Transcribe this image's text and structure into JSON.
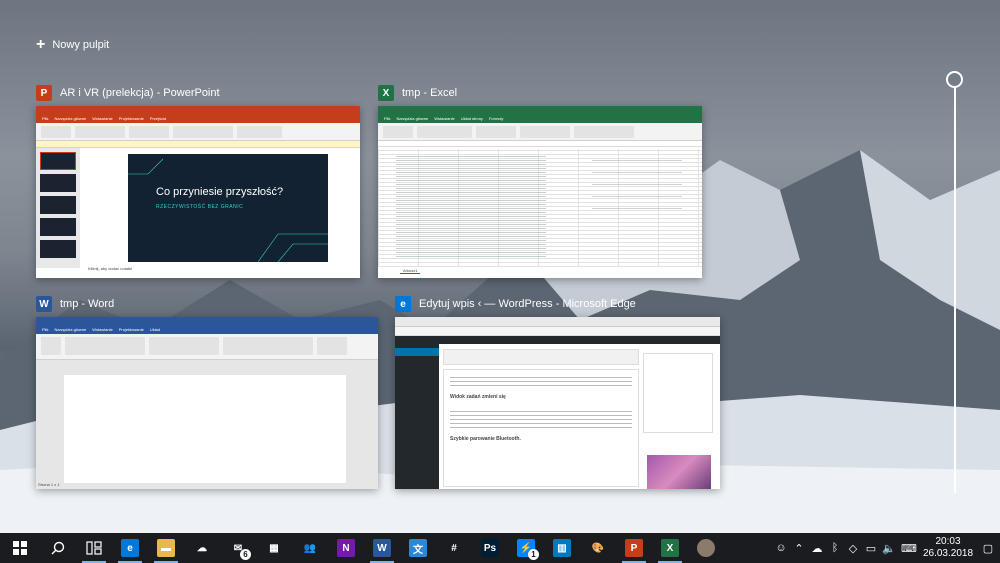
{
  "new_desktop": {
    "label": "Nowy pulpit"
  },
  "windows": [
    {
      "title": "AR i VR (prelekcja) - PowerPoint",
      "icon": "powerpoint-icon",
      "accent": "#c43e1c",
      "slide_title": "Co przyniesie przyszłość?",
      "slide_subtitle": "RZECZYWISTOŚĆ BEZ GRANIC",
      "notes": "Kliknij, aby dodać notatki"
    },
    {
      "title": "tmp - Excel",
      "icon": "excel-icon",
      "accent": "#217346",
      "sheet_tab": "Arkusz1"
    },
    {
      "title": "tmp - Word",
      "icon": "word-icon",
      "accent": "#2b579a",
      "status": "Strona 1 z 1"
    },
    {
      "title": "Edytuj wpis ‹ — WordPress - Microsoft Edge",
      "icon": "edge-icon",
      "accent": "#0078d7",
      "heading_1": "Widok zadań zmieni się",
      "heading_2": "Szybkie parowanie Bluetooth."
    }
  ],
  "taskbar": {
    "apps": [
      {
        "name": "edge-taskbar-icon",
        "color": "#0078d7",
        "glyph": "e",
        "active": true
      },
      {
        "name": "file-explorer-taskbar-icon",
        "color": "#e8b84a",
        "glyph": "▬",
        "active": true
      },
      {
        "name": "onedrive-taskbar-icon",
        "color": "transparent",
        "glyph": "☁",
        "active": false
      },
      {
        "name": "mail-taskbar-icon",
        "color": "transparent",
        "glyph": "✉",
        "active": false,
        "badge": "6"
      },
      {
        "name": "calendar-taskbar-icon",
        "color": "transparent",
        "glyph": "▦",
        "active": false
      },
      {
        "name": "people-taskbar-icon",
        "color": "transparent",
        "glyph": "👥",
        "active": false
      },
      {
        "name": "onenote-taskbar-icon",
        "color": "#7719aa",
        "glyph": "N",
        "active": false
      },
      {
        "name": "word-taskbar-icon",
        "color": "#2b579a",
        "glyph": "W",
        "active": true
      },
      {
        "name": "translator-taskbar-icon",
        "color": "#2c87d6",
        "glyph": "文",
        "active": false
      },
      {
        "name": "slack-taskbar-icon",
        "color": "transparent",
        "glyph": "#",
        "active": false
      },
      {
        "name": "photoshop-taskbar-icon",
        "color": "#001e36",
        "glyph": "Ps",
        "active": false
      },
      {
        "name": "messenger-taskbar-icon",
        "color": "#0084ff",
        "glyph": "⚡",
        "active": false,
        "badge": "1"
      },
      {
        "name": "trello-taskbar-icon",
        "color": "#0079bf",
        "glyph": "▥",
        "active": false
      },
      {
        "name": "paint-taskbar-icon",
        "color": "transparent",
        "glyph": "🎨",
        "active": false
      },
      {
        "name": "powerpoint-taskbar-icon",
        "color": "#c43e1c",
        "glyph": "P",
        "active": true
      },
      {
        "name": "excel-taskbar-icon",
        "color": "#217346",
        "glyph": "X",
        "active": true
      },
      {
        "name": "avatar-taskbar-icon",
        "color": "#8a7b6a",
        "glyph": "",
        "active": false
      }
    ],
    "time": "20:03",
    "date": "26.03.2018"
  }
}
